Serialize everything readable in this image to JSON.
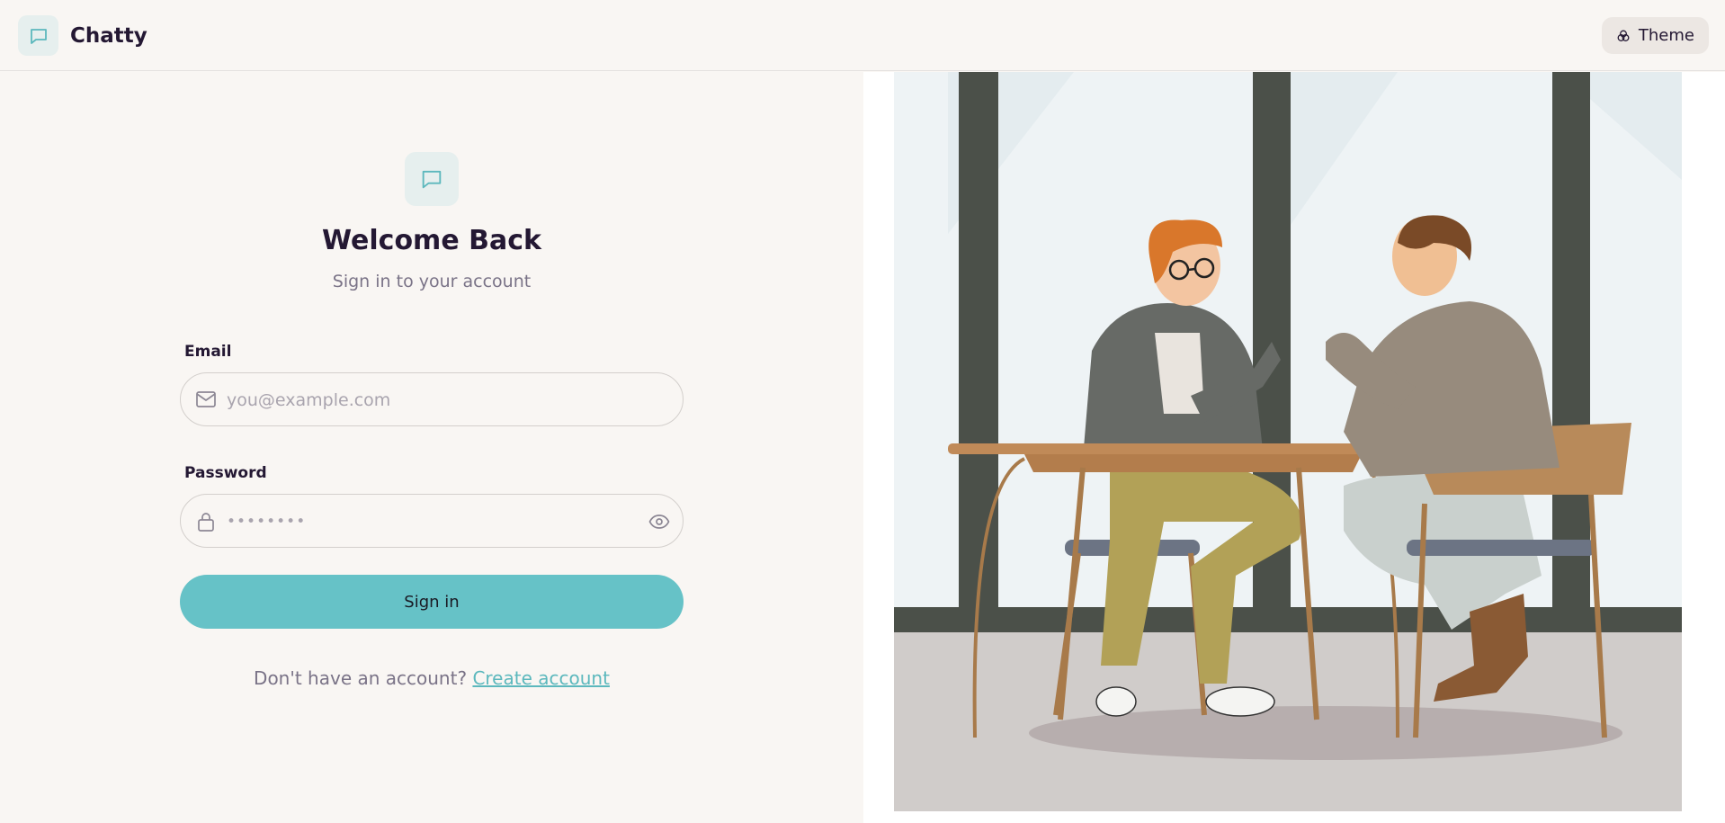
{
  "app": {
    "name": "Chatty"
  },
  "header": {
    "theme_label": "Theme"
  },
  "auth": {
    "title": "Welcome Back",
    "subtitle": "Sign in to your account",
    "email": {
      "label": "Email",
      "placeholder": "you@example.com",
      "value": ""
    },
    "password": {
      "label": "Password",
      "masked_value": "••••••••"
    },
    "submit_label": "Sign in",
    "footer_prompt": "Don't have an account?",
    "footer_link": "Create account"
  },
  "colors": {
    "accent": "#66c2c7",
    "background": "#f9f6f3",
    "text": "#241833",
    "muted": "#7a7387"
  },
  "icons": {
    "brand": "message-square-icon",
    "theme": "palette-icon",
    "email": "mail-icon",
    "password": "lock-icon",
    "reveal": "eye-icon"
  }
}
